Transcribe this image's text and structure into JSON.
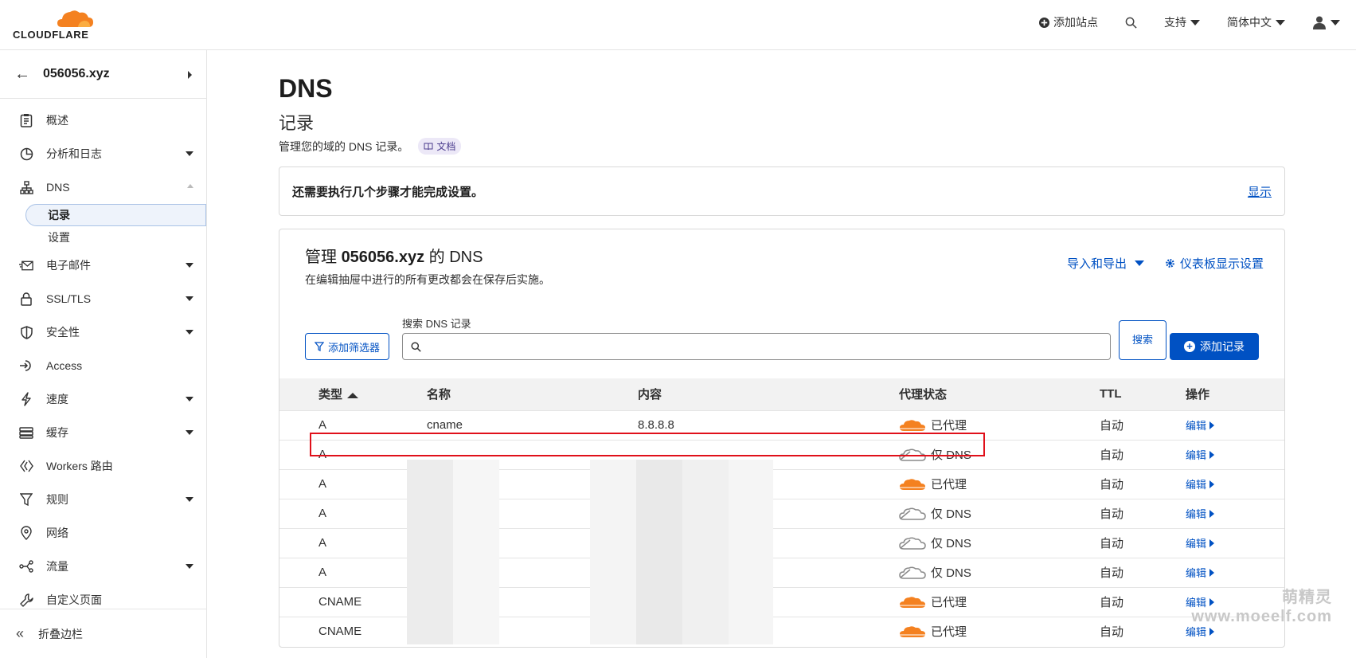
{
  "header": {
    "logo_text": "CLOUDFLARE",
    "add_site": "添加站点",
    "support": "支持",
    "language": "简体中文"
  },
  "sidebar": {
    "domain": "056056.xyz",
    "items": [
      {
        "label": "概述"
      },
      {
        "label": "分析和日志"
      },
      {
        "label": "DNS"
      },
      {
        "label": "电子邮件"
      },
      {
        "label": "SSL/TLS"
      },
      {
        "label": "安全性"
      },
      {
        "label": "Access"
      },
      {
        "label": "速度"
      },
      {
        "label": "缓存"
      },
      {
        "label": "Workers 路由"
      },
      {
        "label": "规则"
      },
      {
        "label": "网络"
      },
      {
        "label": "流量"
      },
      {
        "label": "自定义页面"
      }
    ],
    "dns_sub": [
      "记录",
      "设置"
    ],
    "collapse": "折叠边栏"
  },
  "page": {
    "title": "DNS",
    "subtitle": "记录",
    "description": "管理您的域的 DNS 记录。",
    "docs_badge": "文档",
    "notice": "还需要执行几个步骤才能完成设置。",
    "notice_action": "显示"
  },
  "card": {
    "title_prefix": "管理",
    "title_domain": "056056.xyz",
    "title_suffix": "的 DNS",
    "subtitle": "在编辑抽屉中进行的所有更改都会在保存后实施。",
    "import_export": "导入和导出",
    "dashboard_settings": "仪表板显示设置",
    "add_filter": "添加筛选器",
    "search_label": "搜索 DNS 记录",
    "search_placeholder": "",
    "search_button": "搜索",
    "add_record": "添加记录"
  },
  "table": {
    "headers": [
      "类型",
      "名称",
      "内容",
      "代理状态",
      "TTL",
      "操作"
    ],
    "edit_label": "编辑",
    "rows": [
      {
        "type": "A",
        "name": "cname",
        "content": "8.8.8.8",
        "proxy": "已代理",
        "proxied": true,
        "ttl": "自动"
      },
      {
        "type": "A",
        "name": "",
        "content": "",
        "proxy": "仅 DNS",
        "proxied": false,
        "ttl": "自动"
      },
      {
        "type": "A",
        "name": "",
        "content": "",
        "proxy": "已代理",
        "proxied": true,
        "ttl": "自动"
      },
      {
        "type": "A",
        "name": "",
        "content": "",
        "proxy": "仅 DNS",
        "proxied": false,
        "ttl": "自动"
      },
      {
        "type": "A",
        "name": "",
        "content": "",
        "proxy": "仅 DNS",
        "proxied": false,
        "ttl": "自动"
      },
      {
        "type": "A",
        "name": "",
        "content": "",
        "proxy": "仅 DNS",
        "proxied": false,
        "ttl": "自动"
      },
      {
        "type": "CNAME",
        "name": "",
        "content": "",
        "proxy": "已代理",
        "proxied": true,
        "ttl": "自动"
      },
      {
        "type": "CNAME",
        "name": "",
        "content": "",
        "proxy": "已代理",
        "proxied": true,
        "ttl": "自动"
      }
    ]
  },
  "watermark": {
    "line1": "萌精灵",
    "line2": "www.moeelf.com"
  },
  "colors": {
    "accent": "#0051c3",
    "cloudflare_orange": "#f48120",
    "highlight_red": "#e0101a"
  }
}
